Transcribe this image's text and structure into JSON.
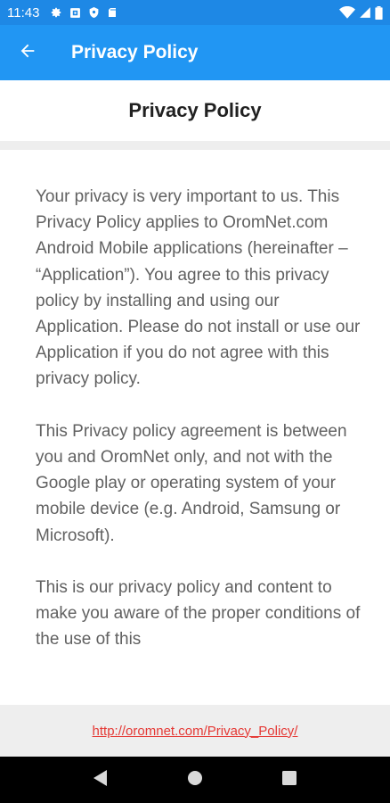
{
  "status_bar": {
    "time": "11:43",
    "left_icons": [
      "gear-icon",
      "record-icon",
      "shield-icon",
      "sd-card-icon"
    ],
    "right_icons": [
      "wifi-icon",
      "signal-icon",
      "battery-icon"
    ]
  },
  "app_bar": {
    "title": "Privacy Policy",
    "back_icon": "arrow-left-icon",
    "color": "#2196f3"
  },
  "header": {
    "title": "Privacy Policy"
  },
  "content": {
    "paragraphs": [
      "Your privacy is very important to us. This Privacy Policy applies to OromNet.com Android Mobile applications (hereinafter – “Application”). You agree to this privacy policy by installing and using our Application. Please do not install or use our Application if you do not agree with this privacy policy.",
      "This Privacy policy agreement is between you and OromNet only, and not with the Google play or operating system of your mobile device (e.g. Android, Samsung or Microsoft).",
      "This is our privacy policy and content to make you aware of the proper conditions of the use of this"
    ]
  },
  "footer": {
    "link": "http://oromnet.com/Privacy_Policy/",
    "link_color": "#e53935"
  },
  "nav_bar": {
    "buttons": [
      "back-triangle-icon",
      "home-circle-icon",
      "recents-square-icon"
    ]
  }
}
